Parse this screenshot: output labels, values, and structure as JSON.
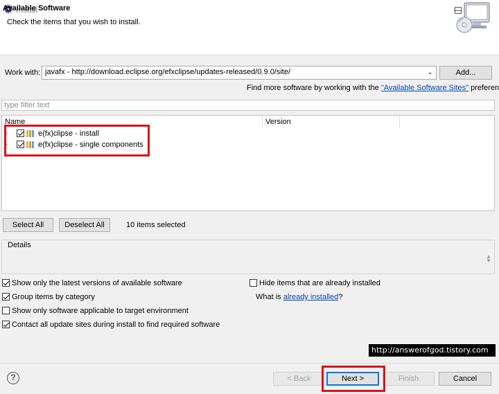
{
  "window": {
    "title": "Install",
    "minimize_glyph": "☐",
    "maximize_glyph": "☐",
    "close_glyph": "✕"
  },
  "header": {
    "title": "Available Software",
    "description": "Check the items that you wish to install.",
    "icon": "monitor-cd-icon"
  },
  "work_with": {
    "label": "Work with:",
    "value": "javafx - http://download.eclipse.org/efxclipse/updates-released/0.9.0/site/",
    "add_label": "Add...",
    "find_more_prefix": "Find more software by working with the ",
    "find_more_link": "\"Available Software Sites\"",
    "find_more_suffix": " preferences."
  },
  "filter": {
    "placeholder": "type filter text"
  },
  "tree": {
    "columns": [
      "Name",
      "Version"
    ],
    "items": [
      {
        "label": "e(fx)clipse - install",
        "checked": true,
        "version": ""
      },
      {
        "label": "e(fx)clipse - single components",
        "checked": true,
        "version": ""
      }
    ]
  },
  "selection": {
    "select_all_label": "Select All",
    "deselect_all_label": "Deselect All",
    "count_text": "10 items selected"
  },
  "details": {
    "label": "Details"
  },
  "options": {
    "latest_versions": {
      "label": "Show only the latest versions of available software",
      "checked": true
    },
    "group_by_category": {
      "label": "Group items by category",
      "checked": true
    },
    "target_env": {
      "label": "Show only software applicable to target environment",
      "checked": false
    },
    "contact_sites": {
      "label": "Contact all update sites during install to find required software",
      "checked": true
    },
    "hide_installed": {
      "label": "Hide items that are already installed",
      "checked": false
    },
    "what_is_prefix": "What is ",
    "what_is_link": "already installed",
    "what_is_suffix": "?"
  },
  "watermark": "http://answerofgod.tistory.com",
  "footer": {
    "help_glyph": "?",
    "back_label": "< Back",
    "next_label": "Next >",
    "finish_label": "Finish",
    "cancel_label": "Cancel"
  },
  "colors": {
    "highlight": "#d9141c",
    "link": "#0645ad",
    "default_button_border": "#0078d7"
  }
}
